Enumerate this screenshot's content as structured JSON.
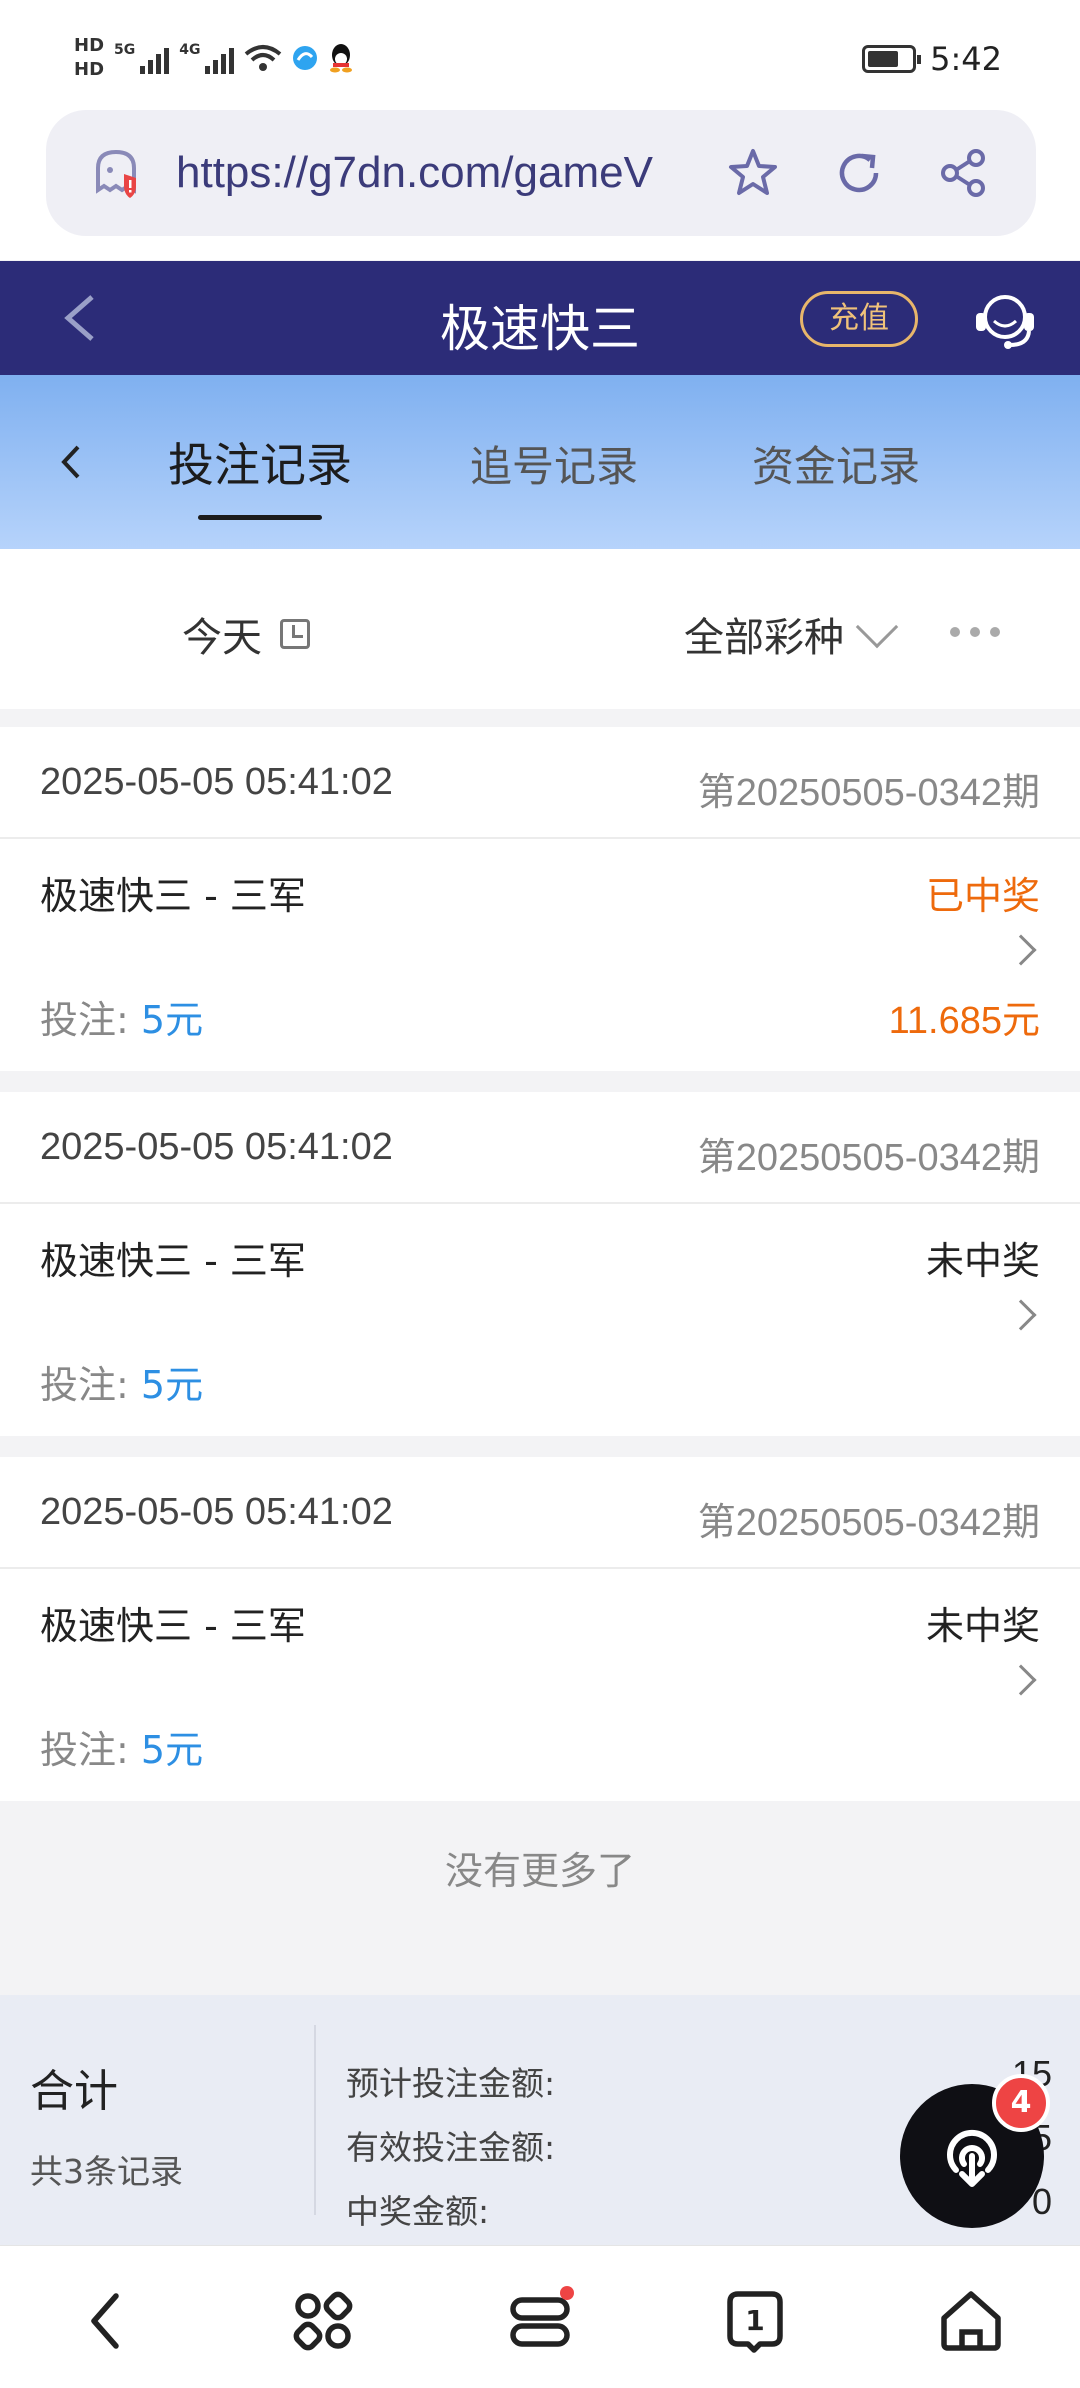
{
  "status_bar": {
    "hd1": "HD",
    "hd2": "HD",
    "net1": "5G",
    "net2": "4G",
    "time": "5:42"
  },
  "browser": {
    "url": "https://g7dn.com/gameV"
  },
  "header": {
    "title": "极速快三",
    "recharge_label": "充值"
  },
  "tabs": {
    "items": [
      {
        "label": "投注记录",
        "active": true
      },
      {
        "label": "追号记录",
        "active": false
      },
      {
        "label": "资金记录",
        "active": false
      }
    ]
  },
  "filter": {
    "date_label": "今天",
    "lottery_label": "全部彩种"
  },
  "records": [
    {
      "time": "2025-05-05 05:41:02",
      "issue": "第20250505-0342期",
      "name": "极速快三 - 三军",
      "status": "已中奖",
      "bet_label": "投注: ",
      "bet_amount": "5元",
      "win_amount": "11.685元"
    },
    {
      "time": "2025-05-05 05:41:02",
      "issue": "第20250505-0342期",
      "name": "极速快三 - 三军",
      "status": "未中奖",
      "bet_label": "投注: ",
      "bet_amount": "5元",
      "win_amount": ""
    },
    {
      "time": "2025-05-05 05:41:02",
      "issue": "第20250505-0342期",
      "name": "极速快三 - 三军",
      "status": "未中奖",
      "bet_label": "投注: ",
      "bet_amount": "5元",
      "win_amount": ""
    }
  ],
  "no_more": "没有更多了",
  "totals": {
    "label": "合计",
    "count": "共3条记录",
    "rows": [
      {
        "label": "预计投注金额:",
        "value": "15"
      },
      {
        "label": "有效投注金额:",
        "value": "5"
      },
      {
        "label": "中奖金额:",
        "value": "0"
      }
    ]
  },
  "fab": {
    "badge": "4"
  },
  "nav_badge": "1",
  "colors": {
    "header_bg": "#2c2c78",
    "win": "#ee6a0c",
    "bet_amount": "#2d8fe3",
    "recharge": "#f0c27a"
  }
}
